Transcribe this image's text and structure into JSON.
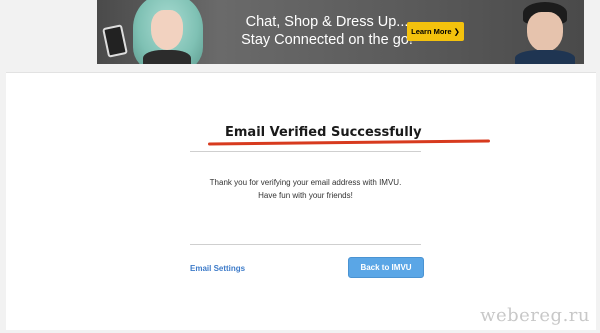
{
  "banner": {
    "tagline_line1": "Chat, Shop & Dress Up...",
    "tagline_line2": "Stay Connected on the go!",
    "learn_more_label": "Learn More",
    "learn_more_arrow": "❯",
    "accent_color": "#f4c20d"
  },
  "main": {
    "title": "Email Verified Successfully",
    "message_line1": "Thank you for verifying your email address with IMVU.",
    "message_line2": "Have fun with your friends!",
    "email_settings_label": "Email Settings",
    "back_button_label": "Back to IMVU",
    "underline_color": "#d73a1e",
    "button_color": "#5aa6e6",
    "link_color": "#3d7bc9"
  },
  "watermark": "webereg.ru"
}
